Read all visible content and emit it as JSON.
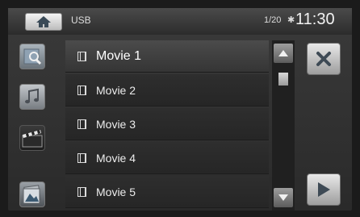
{
  "header": {
    "source": "USB",
    "track_counter": "1/20",
    "bluetooth_symbol": "✱",
    "time": "11:30"
  },
  "sources": [
    {
      "name": "usb-browse-icon"
    },
    {
      "name": "music-icon"
    },
    {
      "name": "video-clapper-icon"
    },
    {
      "name": "photo-icon"
    }
  ],
  "list": {
    "items": [
      {
        "label": "Movie 1",
        "selected": true
      },
      {
        "label": "Movie 2",
        "selected": false
      },
      {
        "label": "Movie 3",
        "selected": false
      },
      {
        "label": "Movie 4",
        "selected": false
      },
      {
        "label": "Movie 5",
        "selected": false
      }
    ]
  },
  "colors": {
    "background": "#1b1b1b",
    "panel": "#2e2e2e",
    "selected_row": "#4b4b4b",
    "button": "#cfcfcf",
    "text": "#ececec"
  }
}
